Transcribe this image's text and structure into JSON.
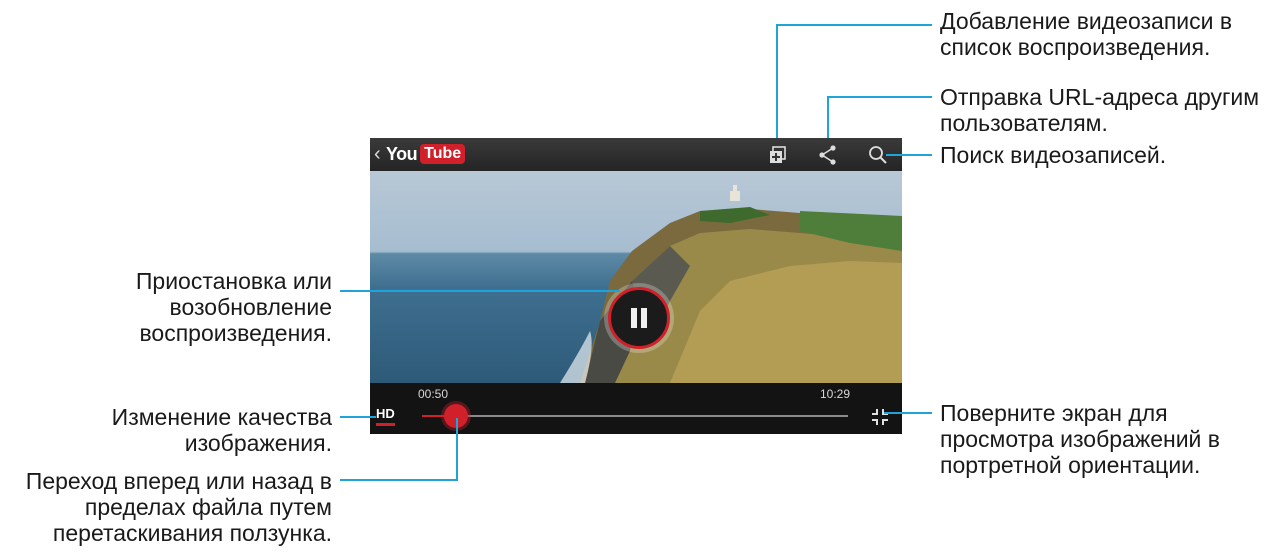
{
  "screen": {
    "topbar": {
      "back_label": "‹",
      "logo_you": "You",
      "logo_tube": "Tube",
      "icons": [
        "add-to-playlist-icon",
        "share-icon",
        "search-icon"
      ]
    },
    "player": {
      "current_time": "00:50",
      "total_time": "10:29",
      "hd_label": "HD",
      "progress": 0.08
    }
  },
  "callouts": {
    "add_playlist": "Добавление видеозаписи в\nсписок воспроизведения.",
    "share": "Отправка URL-адреса другим\nпользователям.",
    "search": "Поиск видеозаписей.",
    "pause": "Приостановка или\nвозобновление\nвоспроизведения.",
    "quality": "Изменение качества\nизображения.",
    "seek": "Переход вперед или назад в\nпределах файла путем\nперетаскивания ползунка.",
    "rotate": "Поверните экран для\nпросмотра изображений в\nпортретной ориентации."
  },
  "colors": {
    "accent": "#d0202a",
    "callout_line": "#1fa3d8"
  }
}
